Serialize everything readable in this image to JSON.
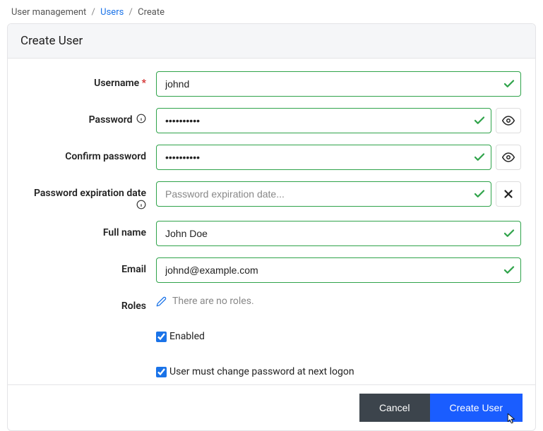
{
  "breadcrumb": {
    "root": "User management",
    "link": "Users",
    "current": "Create"
  },
  "header": {
    "title": "Create User"
  },
  "labels": {
    "username": "Username",
    "password": "Password",
    "confirm_password": "Confirm password",
    "expiration": "Password expiration date",
    "full_name": "Full name",
    "email": "Email",
    "roles": "Roles"
  },
  "fields": {
    "username": "johnd",
    "password": "••••••••••",
    "confirm_password": "••••••••••",
    "expiration_placeholder": "Password expiration date...",
    "full_name": "John Doe",
    "email": "johnd@example.com"
  },
  "roles": {
    "empty_text": "There are no roles."
  },
  "checkboxes": {
    "enabled_label": "Enabled",
    "enabled_checked": true,
    "must_change_label": "User must change password at next logon",
    "must_change_checked": true
  },
  "footer": {
    "cancel": "Cancel",
    "submit": "Create User"
  }
}
